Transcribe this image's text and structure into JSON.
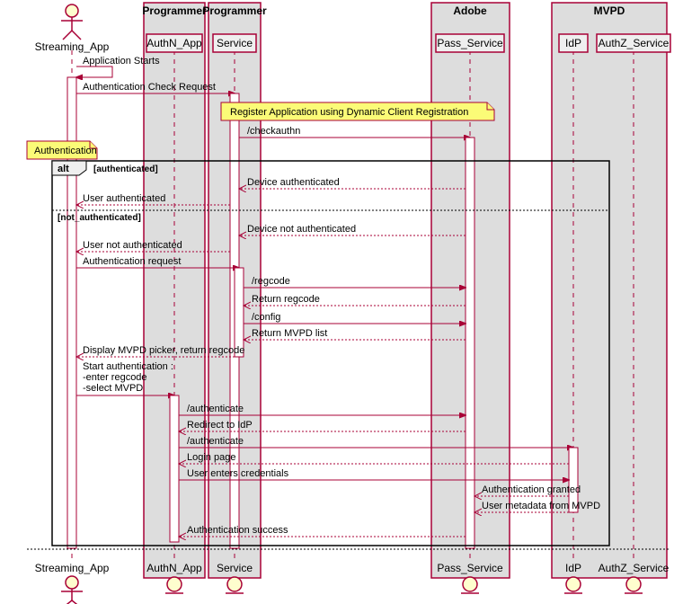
{
  "domain": "Diagram",
  "diagram_type": "UML sequence diagram",
  "actor": "Streaming_App",
  "groups": [
    {
      "name": "Programmer",
      "members": [
        "AuthN_App"
      ]
    },
    {
      "name": "Programmer",
      "members": [
        "Service"
      ]
    },
    {
      "name": "Adobe",
      "members": [
        "Pass_Service"
      ]
    },
    {
      "name": "MVPD",
      "members": [
        "IdP",
        "AuthZ_Service"
      ]
    }
  ],
  "note_auth": "Authentication",
  "note_register": "Register Application using Dynamic Client Registration",
  "alt": {
    "title": "alt",
    "guard1": "[authenticated]",
    "guard2": "[not_authenticated]"
  },
  "messages": {
    "m1": "Application Starts",
    "m2": "Authentication Check Request",
    "m3": "/checkauthn",
    "m4": "Device authenticated",
    "m5": "User authenticated",
    "m6": "Device not authenticated",
    "m7": "User not authenticated",
    "m8": "Authentication request",
    "m9": "/regcode",
    "m10": "Return regcode",
    "m11": "/config",
    "m12": "Return MVPD list",
    "m13": "Display MVPD picker, return regcode",
    "m14": "Start authentication :",
    "m14b": "-enter regcode",
    "m14c": "-select MVPD",
    "m15": "/authenticate",
    "m16": "Redirect to IdP",
    "m17": "/authenticate",
    "m18": "Login page",
    "m19": "User enters credentials",
    "m20": "Authentication granted",
    "m21": "User metadata from MVPD",
    "m22": "Authentication success"
  }
}
